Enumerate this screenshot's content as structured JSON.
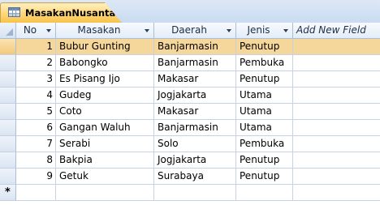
{
  "tab": {
    "title": "MasakanNusantara"
  },
  "columns": [
    "No",
    "Masakan",
    "Daerah",
    "Jenis",
    "Add New Field"
  ],
  "rows": [
    {
      "no": "1",
      "masakan": "Bubur Gunting",
      "daerah": "Banjarmasin",
      "jenis": "Penutup"
    },
    {
      "no": "2",
      "masakan": "Babongko",
      "daerah": "Banjarmasin",
      "jenis": "Pembuka"
    },
    {
      "no": "3",
      "masakan": "Es Pisang Ijo",
      "daerah": "Makasar",
      "jenis": "Penutup"
    },
    {
      "no": "4",
      "masakan": "Gudeg",
      "daerah": "Jogjakarta",
      "jenis": "Utama"
    },
    {
      "no": "5",
      "masakan": "Coto",
      "daerah": "Makasar",
      "jenis": "Utama"
    },
    {
      "no": "6",
      "masakan": "Gangan Waluh",
      "daerah": "Banjarmasin",
      "jenis": "Utama"
    },
    {
      "no": "7",
      "masakan": "Serabi",
      "daerah": "Solo",
      "jenis": "Pembuka"
    },
    {
      "no": "8",
      "masakan": "Bakpia",
      "daerah": "Jogjakarta",
      "jenis": "Penutup"
    },
    {
      "no": "9",
      "masakan": "Getuk",
      "daerah": "Surabaya",
      "jenis": "Penutup"
    }
  ],
  "new_row_marker": "*",
  "current_row": 1,
  "icons": {
    "tab": "table-icon",
    "header_dropdown": "dropdown-arrow-icon",
    "new_record": "new-record-icon"
  }
}
